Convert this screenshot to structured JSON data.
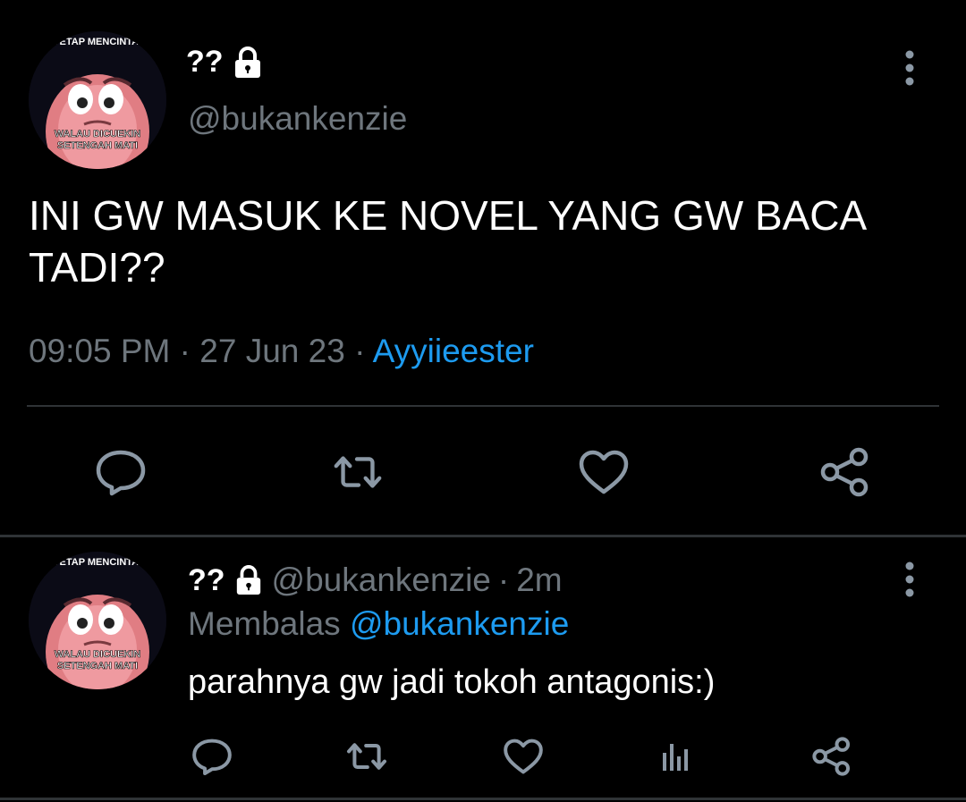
{
  "main_tweet": {
    "display_name": "??",
    "handle": "@bukankenzie",
    "text": "INI GW MASUK KE NOVEL YANG GW BACA TADI??",
    "time": "09:05 PM",
    "date": "27 Jun 23",
    "source": "Ayyiieester",
    "separator": "·",
    "avatar_caption_top": "TETAP MENCINTAI",
    "avatar_caption_bottom_1": "WALAU DICUEKIN",
    "avatar_caption_bottom_2": "SETENGAH MATI",
    "icons": [
      "lock-icon",
      "more-icon",
      "reply-icon",
      "retweet-icon",
      "like-icon",
      "share-icon"
    ]
  },
  "reply_tweet": {
    "display_name": "??",
    "handle": "@bukankenzie",
    "separator": "·",
    "age": "2m",
    "replying_label": "Membalas",
    "replying_to": "@bukankenzie",
    "text": "parahnya gw jadi tokoh antagonis:)",
    "avatar_caption_top": "TETAP MENCINTAI",
    "avatar_caption_bottom_1": "WALAU DICUEKIN",
    "avatar_caption_bottom_2": "SETENGAH MATI",
    "icons": [
      "lock-icon",
      "more-icon",
      "reply-icon",
      "retweet-icon",
      "like-icon",
      "stats-icon",
      "share-icon"
    ]
  },
  "colors": {
    "background": "#000000",
    "text": "#ffffff",
    "muted": "#6e767d",
    "link": "#1d9bf0",
    "divider": "#2f3336",
    "icon": "#8b98a5"
  }
}
